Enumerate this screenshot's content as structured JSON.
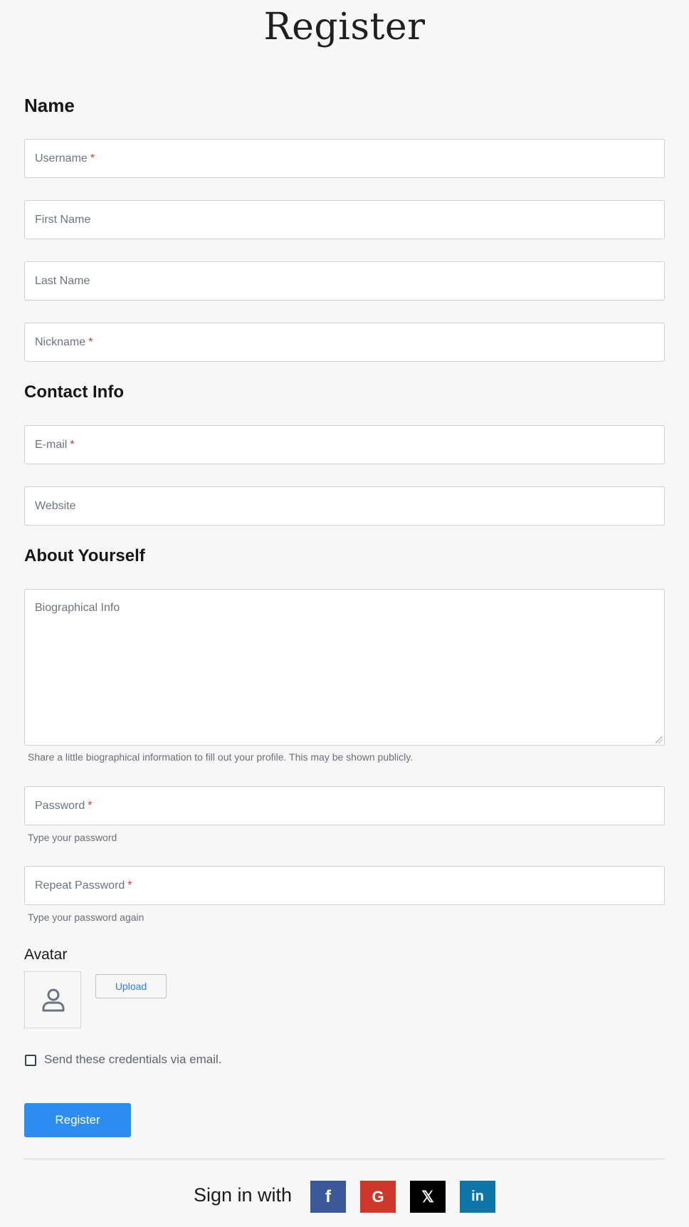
{
  "page": {
    "title": "Register"
  },
  "sections": {
    "name": "Name",
    "contact": "Contact Info",
    "about": "About Yourself"
  },
  "fields": {
    "username": {
      "placeholder": "Username",
      "required": "*"
    },
    "first_name": {
      "placeholder": "First Name"
    },
    "last_name": {
      "placeholder": "Last Name"
    },
    "nickname": {
      "placeholder": "Nickname",
      "required": "*"
    },
    "email": {
      "placeholder": "E-mail",
      "required": "*"
    },
    "website": {
      "placeholder": "Website"
    },
    "bio": {
      "placeholder": "Biographical Info",
      "help": "Share a little biographical information to fill out your profile. This may be shown publicly."
    },
    "password": {
      "placeholder": "Password",
      "required": "*",
      "help": "Type your password"
    },
    "repeat_password": {
      "placeholder": "Repeat Password",
      "required": "*",
      "help": "Type your password again"
    }
  },
  "avatar": {
    "label": "Avatar",
    "icon": "user-icon",
    "upload_label": "Upload"
  },
  "send_credentials": {
    "label": "Send these credentials via email.",
    "checked": false
  },
  "register_button": "Register",
  "social": {
    "label": "Sign in with",
    "buttons": [
      {
        "name": "facebook",
        "glyph": "f",
        "color": "#3b5998"
      },
      {
        "name": "google",
        "glyph": "G",
        "color": "#d0372b"
      },
      {
        "name": "x",
        "glyph": "𝕏",
        "color": "#000000"
      },
      {
        "name": "linkedin",
        "glyph": "in",
        "color": "#0e76a8"
      }
    ]
  }
}
